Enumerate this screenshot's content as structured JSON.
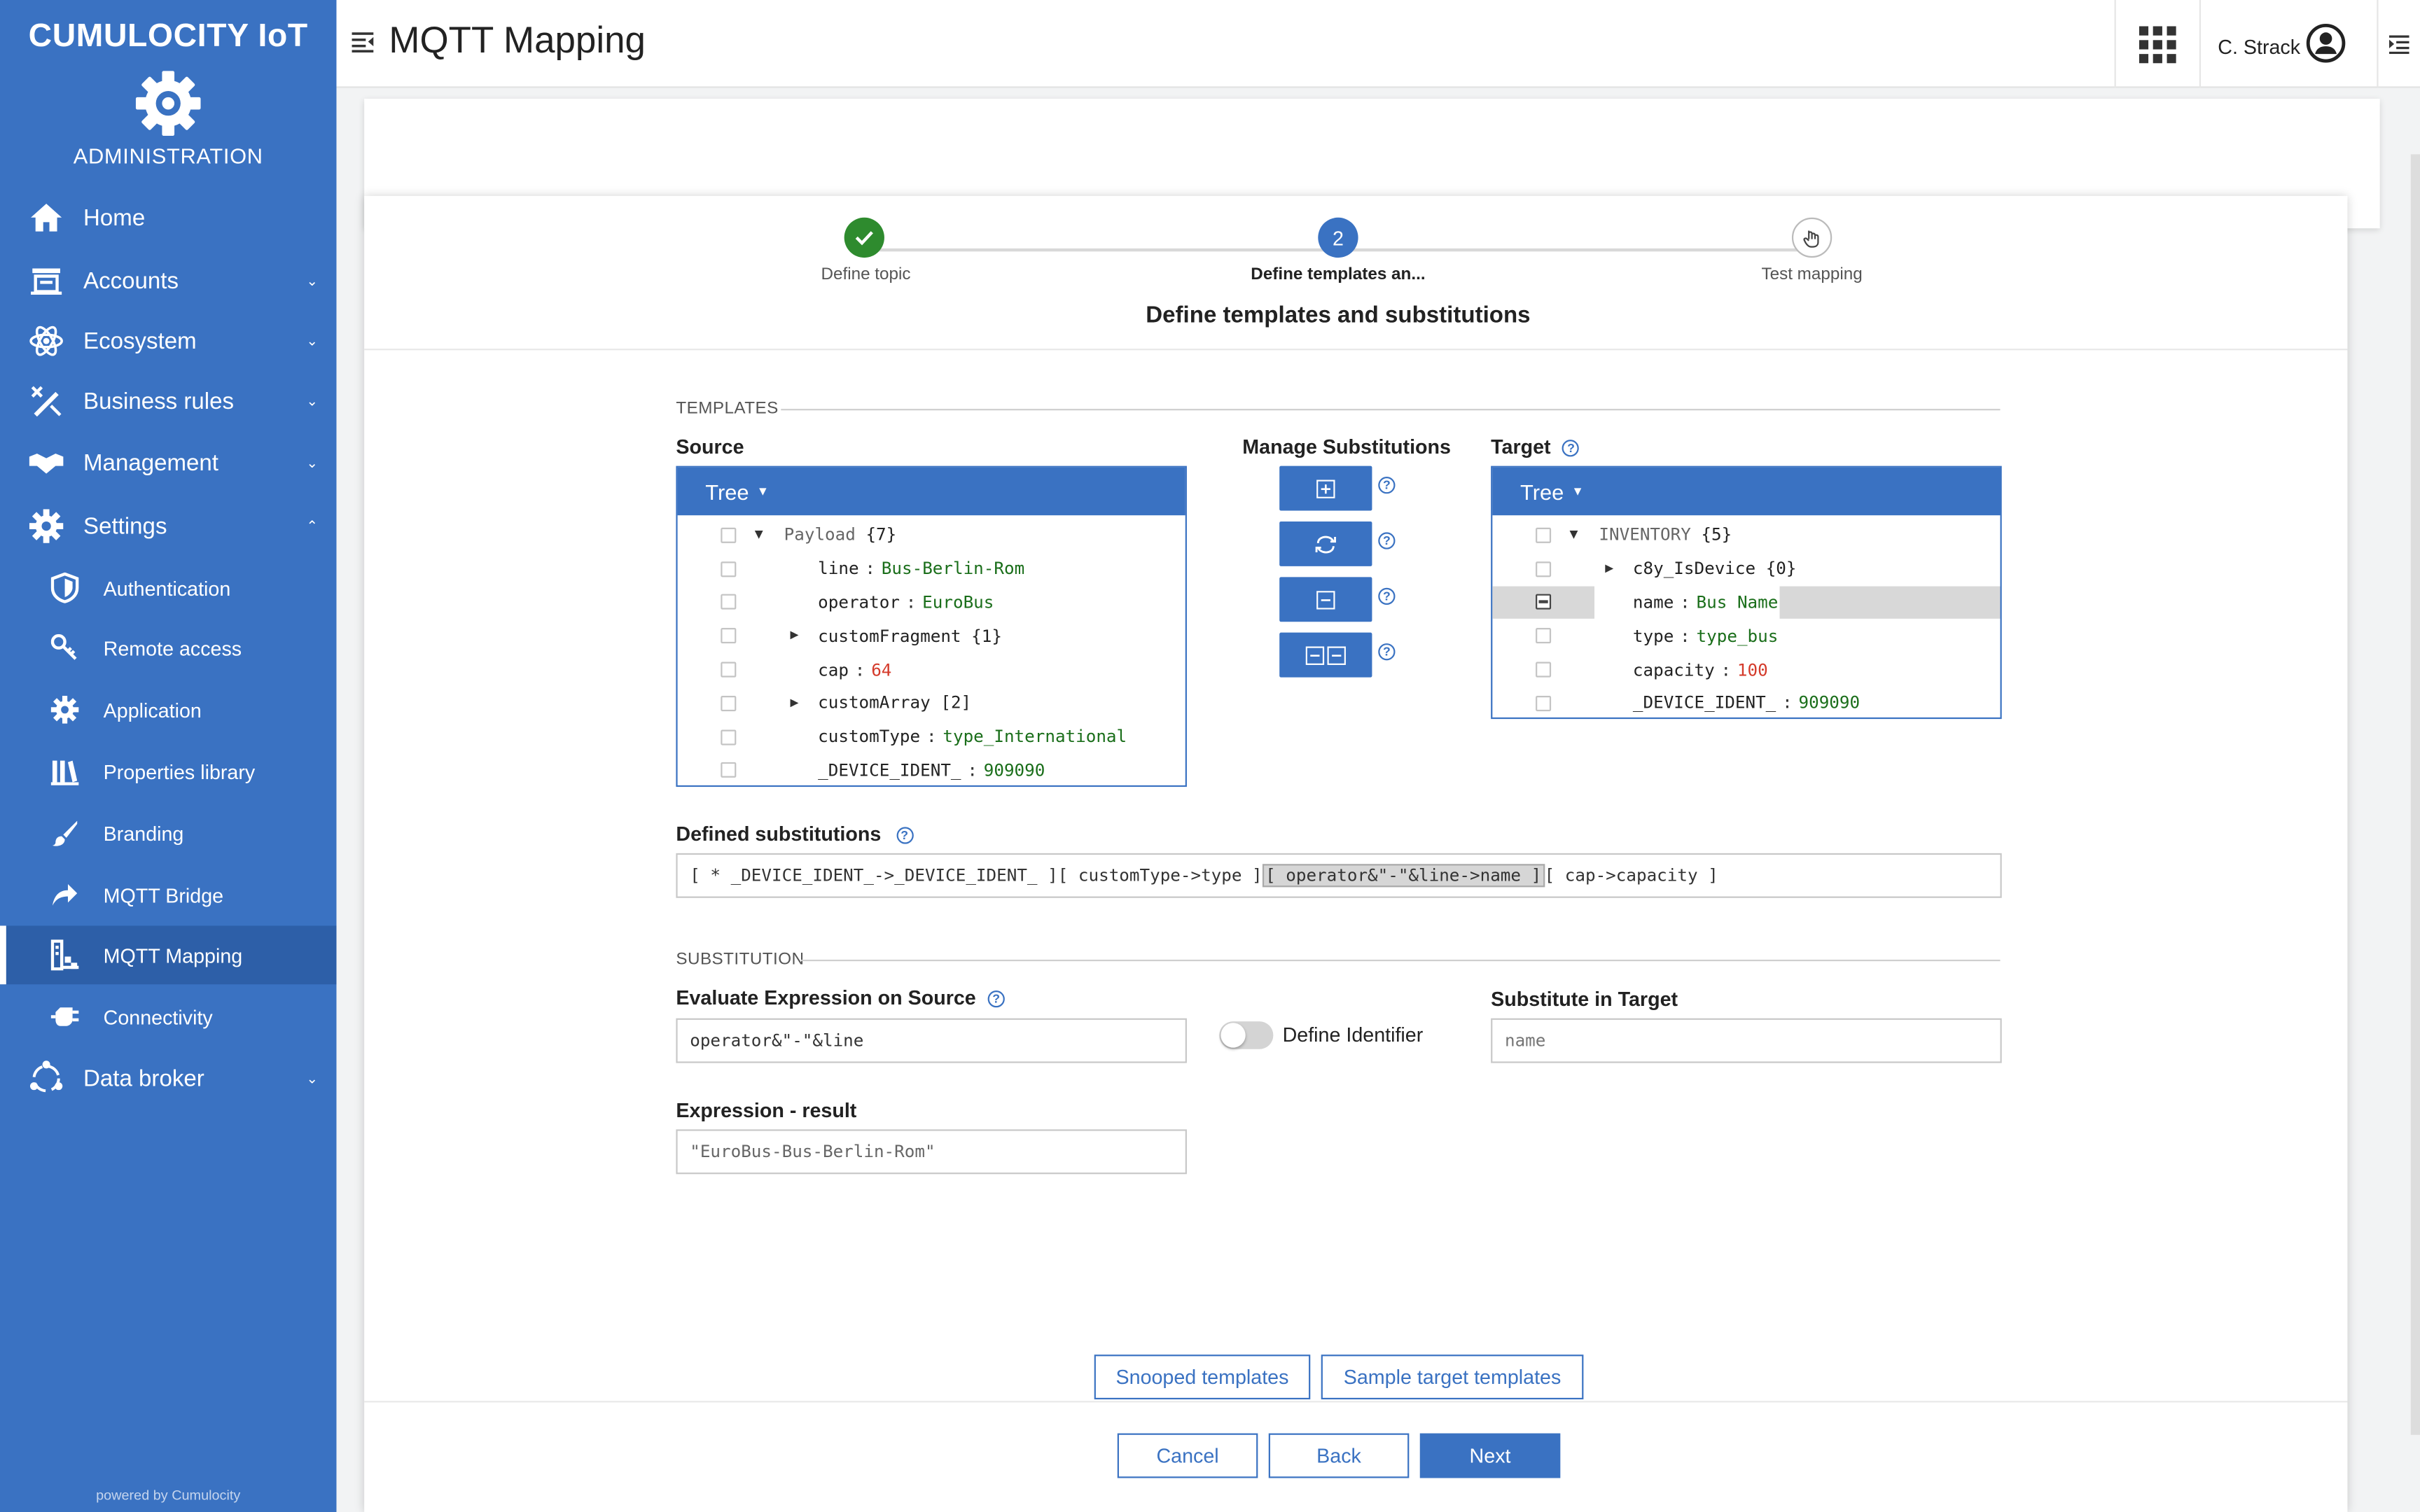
{
  "sidebar": {
    "brand": "CUMULOCITY IoT",
    "app_name": "ADMINISTRATION",
    "powered_by": "powered by Cumulocity",
    "nav": [
      {
        "label": "Home",
        "icon": "home-icon"
      },
      {
        "label": "Accounts",
        "icon": "accounts-icon"
      },
      {
        "label": "Ecosystem",
        "icon": "ecosystem-icon"
      },
      {
        "label": "Business rules",
        "icon": "business-rules-icon"
      },
      {
        "label": "Management",
        "icon": "handshake-icon"
      },
      {
        "label": "Settings",
        "icon": "gear-icon"
      },
      {
        "label": "Data broker",
        "icon": "data-broker-icon"
      }
    ],
    "settings_items": [
      {
        "label": "Authentication",
        "icon": "shield-icon"
      },
      {
        "label": "Remote access",
        "icon": "key-icon"
      },
      {
        "label": "Application",
        "icon": "gear-icon"
      },
      {
        "label": "Properties library",
        "icon": "library-icon"
      },
      {
        "label": "Branding",
        "icon": "brush-icon"
      },
      {
        "label": "MQTT Bridge",
        "icon": "share-icon"
      },
      {
        "label": "MQTT Mapping",
        "icon": "mapping-icon"
      },
      {
        "label": "Connectivity",
        "icon": "plug-icon"
      }
    ],
    "active_item": "MQTT Mapping",
    "brand_color": "#3a72c2"
  },
  "header": {
    "title": "MQTT Mapping",
    "user": "C. Strack"
  },
  "stepper": {
    "steps": [
      {
        "label": "Define topic",
        "state": "done"
      },
      {
        "label": "Define templates an...",
        "state": "active",
        "number": "2"
      },
      {
        "label": "Test mapping",
        "state": "pending"
      }
    ],
    "title": "Define templates and substitutions"
  },
  "templates": {
    "caption": "TEMPLATES",
    "source_label": "Source",
    "manage_label": "Manage Substitutions",
    "target_label": "Target",
    "view_mode": "Tree",
    "source_tree": {
      "root": "Payload",
      "root_count": "{7}",
      "rows": [
        {
          "key": "line",
          "value": "Bus-Berlin-Rom"
        },
        {
          "key": "operator",
          "value": "EuroBus"
        },
        {
          "key": "customFragment",
          "count": "{1}"
        },
        {
          "key": "cap",
          "value": "64"
        },
        {
          "key": "customArray",
          "count": "[2]"
        },
        {
          "key": "customType",
          "value": "type_International"
        },
        {
          "key": "_DEVICE_IDENT_",
          "value": "909090"
        }
      ]
    },
    "target_tree": {
      "root": "INVENTORY",
      "root_count": "{5}",
      "rows": [
        {
          "key": "c8y_IsDevice",
          "count": "{0}"
        },
        {
          "key": "name",
          "value": "Bus Name"
        },
        {
          "key": "type",
          "value": "type_bus"
        },
        {
          "key": "capacity",
          "value": "100"
        },
        {
          "key": "_DEVICE_IDENT_",
          "value": "909090"
        }
      ]
    }
  },
  "defined_substitutions": {
    "label": "Defined substitutions",
    "items": [
      "[ * _DEVICE_IDENT_->_DEVICE_IDENT_ ]",
      "[ customType->type ]",
      "[ operator&\"-\"&line->name ]",
      "[ cap->capacity ]"
    ]
  },
  "substitution": {
    "caption": "SUBSTITUTION",
    "expression_label": "Evaluate Expression on Source",
    "expression_value": "operator&\"-\"&line",
    "define_identifier_label": "Define Identifier",
    "define_identifier_on": false,
    "target_label": "Substitute in Target",
    "target_placeholder": "name",
    "result_label": "Expression - result",
    "result_value": "\"EuroBus-Bus-Berlin-Rom\""
  },
  "footer": {
    "snooped": "Snooped templates",
    "sample": "Sample target templates",
    "cancel": "Cancel",
    "back": "Back",
    "next": "Next"
  }
}
